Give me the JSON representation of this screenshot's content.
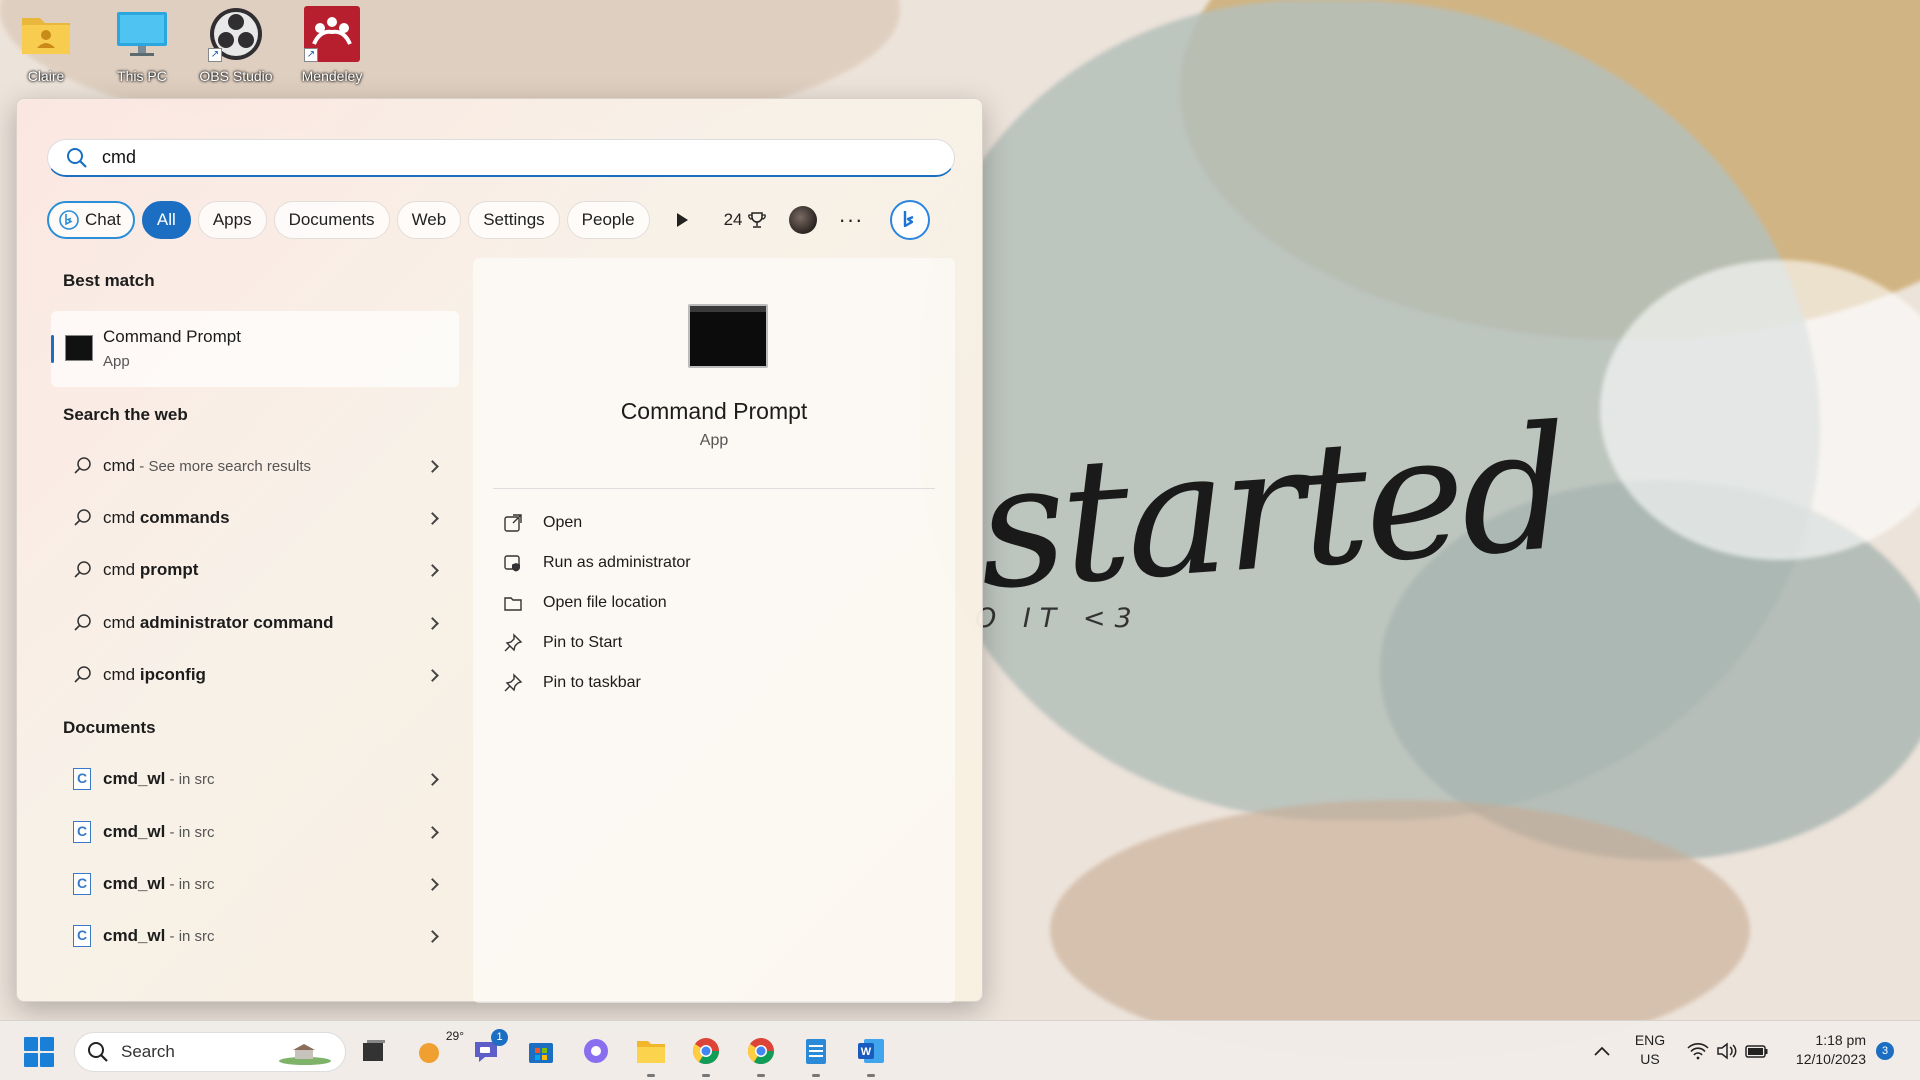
{
  "desktop": {
    "icons": [
      {
        "label": "Claire",
        "icon": "user-folder-icon"
      },
      {
        "label": "This PC",
        "icon": "monitor-icon"
      },
      {
        "label": "OBS Studio",
        "icon": "obs-icon"
      },
      {
        "label": "Mendeley",
        "icon": "mendeley-icon"
      }
    ],
    "wallpaper_text": "started",
    "wallpaper_subtext": "O IT <3"
  },
  "search": {
    "query": "cmd",
    "filters": [
      "Chat",
      "All",
      "Apps",
      "Documents",
      "Web",
      "Settings",
      "People"
    ],
    "active_filter": "All",
    "rewards_points": "24"
  },
  "results": {
    "best_match_title": "Best match",
    "best_match": {
      "name": "Command Prompt",
      "type": "App"
    },
    "web_title": "Search the web",
    "web": [
      {
        "prefix": "cmd",
        "bold": "",
        "muted": " - See more search results"
      },
      {
        "prefix": "cmd ",
        "bold": "commands",
        "muted": ""
      },
      {
        "prefix": "cmd ",
        "bold": "prompt",
        "muted": ""
      },
      {
        "prefix": "cmd ",
        "bold": "administrator command",
        "muted": ""
      },
      {
        "prefix": "cmd ",
        "bold": "ipconfig",
        "muted": ""
      }
    ],
    "documents_title": "Documents",
    "documents": [
      {
        "name": "cmd_wl",
        "location": " - in src"
      },
      {
        "name": "cmd_wl",
        "location": " - in src"
      },
      {
        "name": "cmd_wl",
        "location": " - in src"
      },
      {
        "name": "cmd_wl",
        "location": " - in src"
      }
    ]
  },
  "preview": {
    "name": "Command Prompt",
    "type": "App",
    "actions": [
      {
        "label": "Open",
        "icon": "open-external-icon"
      },
      {
        "label": "Run as administrator",
        "icon": "shield-admin-icon"
      },
      {
        "label": "Open file location",
        "icon": "folder-icon"
      },
      {
        "label": "Pin to Start",
        "icon": "pin-icon"
      },
      {
        "label": "Pin to taskbar",
        "icon": "pin-icon"
      }
    ]
  },
  "taskbar": {
    "search_label": "Search",
    "weather_temp": "29°",
    "teams_badge": "1",
    "language": "ENG",
    "region": "US",
    "time": "1:18 pm",
    "date": "12/10/2023",
    "notification_count": "3"
  },
  "colors": {
    "accent": "#1b6ec2",
    "chat_border": "#2a8fd8"
  }
}
